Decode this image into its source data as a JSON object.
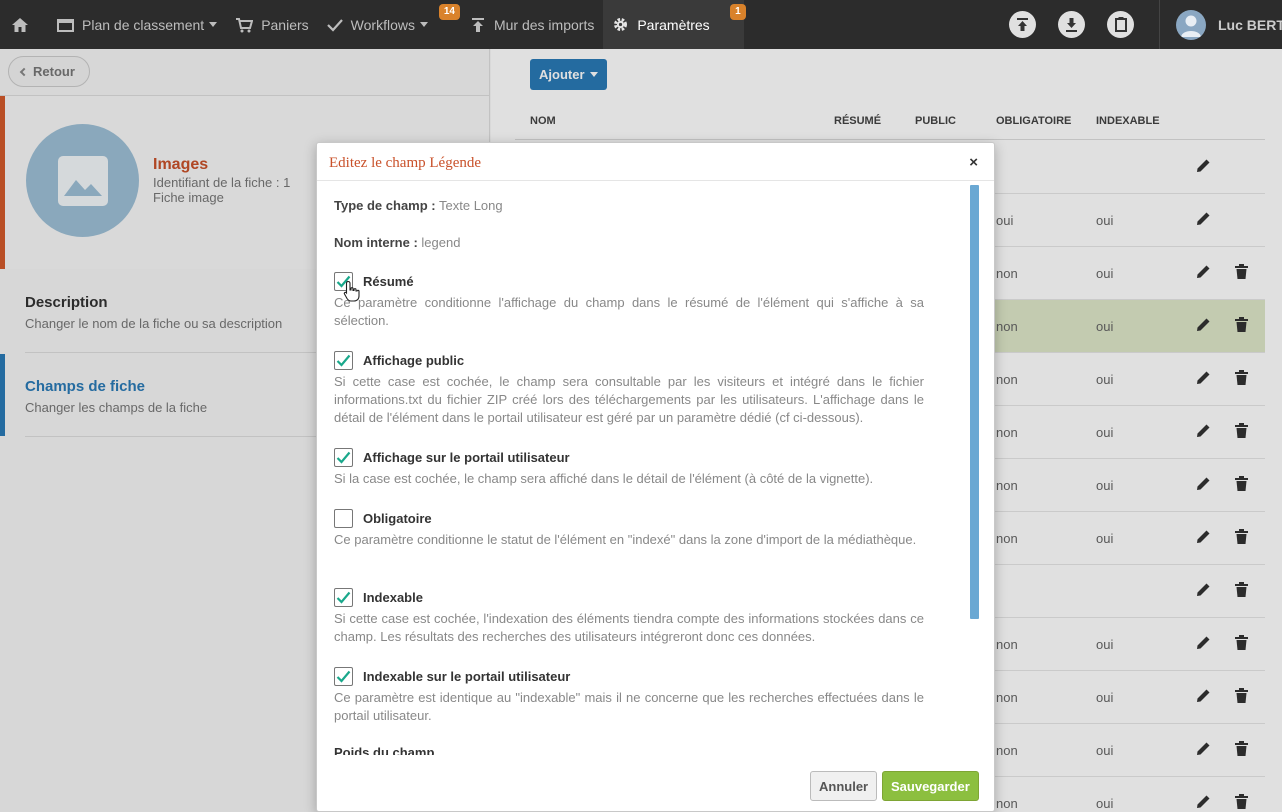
{
  "nav": {
    "home_icon": "home-icon",
    "items": [
      {
        "label": "Plan de classement",
        "icon": "folder-icon",
        "caret": true
      },
      {
        "label": "Paniers",
        "icon": "cart-icon"
      },
      {
        "label": "Workflows",
        "icon": "check-icon",
        "caret": true,
        "badge": "14"
      },
      {
        "label": "Mur des imports",
        "icon": "upload-arrow-icon"
      },
      {
        "label": "Paramètres",
        "icon": "gear-icon",
        "badge": "1",
        "active": true
      }
    ],
    "user_name": "Luc BERTIN"
  },
  "left": {
    "back_label": "Retour",
    "fiche_title": "Images",
    "fiche_id": "Identifiant de la fiche : 1",
    "fiche_type": "Fiche image",
    "menu": [
      {
        "title": "Description",
        "subtitle": "Changer le nom de la fiche ou sa description"
      },
      {
        "title": "Champs de fiche",
        "subtitle": "Changer les champs de la fiche"
      }
    ]
  },
  "table": {
    "add_label": "Ajouter",
    "headers": {
      "name": "NOM",
      "resume": "RÉSUMÉ",
      "public": "PUBLIC",
      "obligatoire": "OBLIGATOIRE",
      "indexable": "INDEXABLE"
    },
    "rows": [
      {
        "obligatoire": "",
        "indexable": "",
        "delete": false
      },
      {
        "obligatoire": "oui",
        "indexable": "oui",
        "delete": false
      },
      {
        "obligatoire": "non",
        "indexable": "oui",
        "delete": true
      },
      {
        "obligatoire": "non",
        "indexable": "oui",
        "delete": true,
        "highlight": true
      },
      {
        "obligatoire": "non",
        "indexable": "oui",
        "delete": true
      },
      {
        "obligatoire": "non",
        "indexable": "oui",
        "delete": true
      },
      {
        "obligatoire": "non",
        "indexable": "oui",
        "delete": true
      },
      {
        "obligatoire": "non",
        "indexable": "oui",
        "delete": true
      },
      {
        "obligatoire": "",
        "indexable": "",
        "delete": true
      },
      {
        "obligatoire": "non",
        "indexable": "oui",
        "delete": true
      },
      {
        "obligatoire": "non",
        "indexable": "oui",
        "delete": true
      },
      {
        "obligatoire": "non",
        "indexable": "oui",
        "delete": true
      },
      {
        "obligatoire": "non",
        "indexable": "oui",
        "delete": true
      }
    ]
  },
  "modal": {
    "title": "Editez le champ Légende",
    "close": "×",
    "type_label": "Type de champ :",
    "type_value": "Texte Long",
    "internal_label": "Nom interne :",
    "internal_value": "legend",
    "options": [
      {
        "label": "Résumé",
        "checked": true,
        "desc": "Ce paramètre conditionne l'affichage du champ dans le résumé de l'élément qui s'affiche à sa sélection."
      },
      {
        "label": "Affichage public",
        "checked": true,
        "desc": "Si cette case est cochée, le champ sera consultable par les visiteurs et intégré dans le fichier informations.txt du fichier ZIP créé lors des téléchargements par les utilisateurs. L'affichage dans le détail de l'élément dans le portail utilisateur est géré par un paramètre dédié (cf ci-dessous)."
      },
      {
        "label": "Affichage sur le portail utilisateur",
        "checked": true,
        "desc": "Si la case est cochée, le champ sera affiché dans le détail de l'élément (à côté de la vignette)."
      },
      {
        "label": "Obligatoire",
        "checked": false,
        "desc": "Ce paramètre conditionne le statut de l'élément en \"indexé\" dans la zone d'import de la médiathèque."
      },
      {
        "label": "Indexable",
        "checked": true,
        "desc": "Si cette case est cochée, l'indexation des éléments tiendra compte des informations stockées dans ce champ. Les résultats des recherches des utilisateurs intégreront donc ces données."
      },
      {
        "label": "Indexable sur le portail utilisateur",
        "checked": true,
        "desc": "Ce paramètre est identique au \"indexable\" mais il ne concerne que les recherches effectuées dans le portail utilisateur."
      }
    ],
    "poids_label": "Poids du champ",
    "cancel_label": "Annuler",
    "save_label": "Sauvegarder"
  },
  "colors": {
    "accent": "#2a7ab7",
    "brand_orange": "#c9512a",
    "check_teal": "#1aa88b",
    "save_green": "#8cbf3f",
    "badge": "#d9822b"
  }
}
